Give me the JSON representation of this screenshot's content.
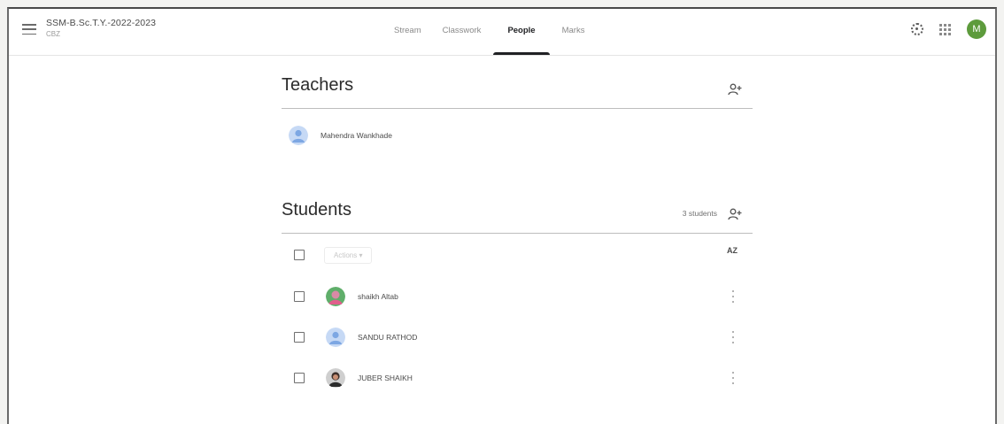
{
  "header": {
    "class_title": "SSM-B.Sc.T.Y.-2022-2023",
    "class_subtitle": "CBZ",
    "tabs": [
      {
        "label": "Stream",
        "active": false
      },
      {
        "label": "Classwork",
        "active": false
      },
      {
        "label": "People",
        "active": true
      },
      {
        "label": "Marks",
        "active": false
      }
    ],
    "account_initial": "M",
    "account_color": "#5d9b3c"
  },
  "teachers": {
    "title": "Teachers",
    "list": [
      {
        "name": "Mahendra Wankhade",
        "avatar": "default-avatar"
      }
    ]
  },
  "students": {
    "title": "Students",
    "count_label": "3 students",
    "actions_label": "Actions",
    "sort_label": "AZ",
    "list": [
      {
        "name": "shaikh Altab",
        "avatar": "photo-avatar"
      },
      {
        "name": "SANDU RATHOD",
        "avatar": "default-avatar"
      },
      {
        "name": "JUBER SHAIKH",
        "avatar": "photo-avatar"
      }
    ]
  },
  "icons": {
    "menu": "hamburger-menu-icon",
    "settings": "gear-icon",
    "apps": "apps-grid-icon",
    "invite": "add-person-icon",
    "more": "kebab-menu-icon",
    "sort": "sort-alpha-icon"
  }
}
